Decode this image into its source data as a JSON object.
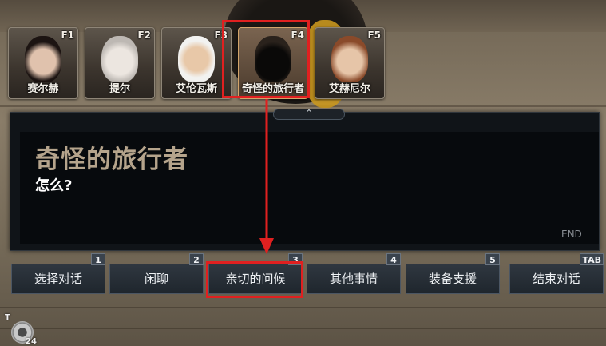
{
  "portraits": [
    {
      "key": "F1",
      "name": "赛尔赫",
      "active": false
    },
    {
      "key": "F2",
      "name": "提尔",
      "active": false
    },
    {
      "key": "F3",
      "name": "艾伦瓦斯",
      "active": false
    },
    {
      "key": "F4",
      "name": "奇怪的旅行者",
      "active": true
    },
    {
      "key": "F5",
      "name": "艾赫尼尔",
      "active": false
    }
  ],
  "dialog": {
    "collapse_glyph": "⌃",
    "speaker": "奇怪的旅行者",
    "line": "怎么?",
    "end_label": "END"
  },
  "actions": [
    {
      "key": "1",
      "label": "选择对话"
    },
    {
      "key": "2",
      "label": "闲聊"
    },
    {
      "key": "3",
      "label": "亲切的问候"
    },
    {
      "key": "4",
      "label": "其他事情"
    },
    {
      "key": "5",
      "label": "装备支援"
    },
    {
      "key": "TAB",
      "label": "结束对话"
    }
  ],
  "hud": {
    "letter": "T",
    "count": "24"
  },
  "colors": {
    "highlight": "#e02020",
    "speaker": "#b5a48c",
    "panel": "#101418"
  }
}
